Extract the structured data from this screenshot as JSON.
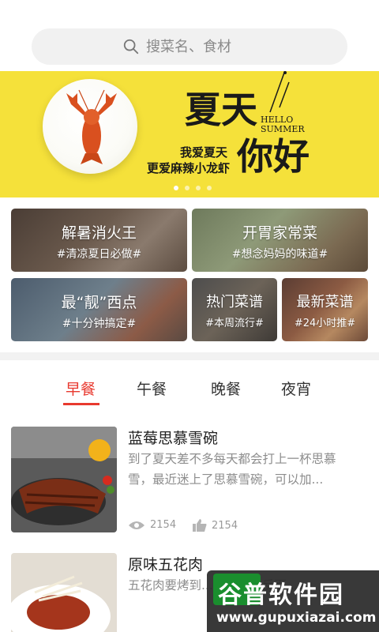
{
  "search": {
    "placeholder": "搜菜名、食材"
  },
  "banner": {
    "title_line1": "夏天",
    "title_line2": "你好",
    "hello": "HELLO",
    "summer": "SUMMER",
    "slogan1": "我爱夏天",
    "slogan2": "更爱麻辣小龙虾",
    "slide_count": 4,
    "active_slide": 1
  },
  "categories": [
    {
      "title": "解暑消火王",
      "subtitle": "#清凉夏日必做#"
    },
    {
      "title": "开胃家常菜",
      "subtitle": "#想念妈妈的味道#"
    },
    {
      "title": "最“靓”西点",
      "subtitle": "#十分钟搞定#"
    },
    {
      "title": "热门菜谱",
      "subtitle": "#本周流行#"
    },
    {
      "title": "最新菜谱",
      "subtitle": "#24小时推#"
    }
  ],
  "tabs": [
    {
      "label": "早餐",
      "active": true
    },
    {
      "label": "午餐",
      "active": false
    },
    {
      "label": "晚餐",
      "active": false
    },
    {
      "label": "夜宵",
      "active": false
    }
  ],
  "recipes": [
    {
      "title": "蓝莓思慕雪碗",
      "desc": "到了夏天差不多每天都会打上一杯思慕雪，最近迷上了思慕雪碗，可以加...",
      "views": "2154",
      "likes": "2154"
    },
    {
      "title": "原味五花肉",
      "desc": "五花肉要烤到...五花肉，反而..."
    }
  ],
  "watermark": {
    "name": "谷普软件园",
    "url": "www.gupuxiazai.com"
  },
  "colors": {
    "accent": "#e8392f",
    "banner": "#f5e13a"
  }
}
